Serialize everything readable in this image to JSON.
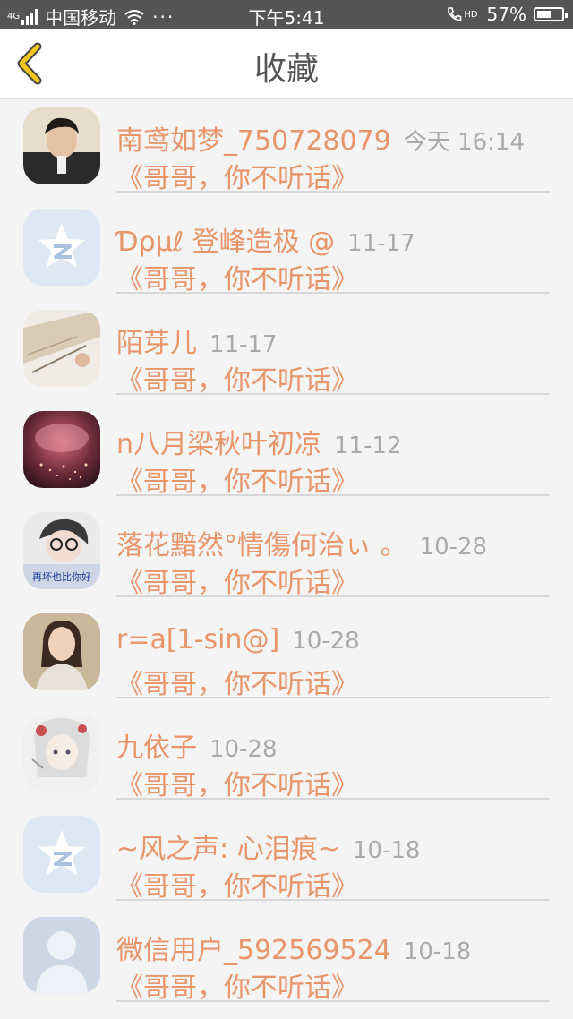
{
  "status_bar": {
    "carrier": "中国移动",
    "time": "下午5:41",
    "battery": "57%",
    "battery_level": 0.57,
    "network": "4G",
    "hd": "HD"
  },
  "header": {
    "title": "收藏"
  },
  "favorites": [
    {
      "name": "南鸢如梦_750728079",
      "time": "今天 16:14",
      "content": "《哥哥，你不听话》",
      "avatar": "photo-boy"
    },
    {
      "name": "Ɗρμℓ 登峰造极 @",
      "time": "11-17",
      "content": "《哥哥，你不听话》",
      "avatar": "qzone-star"
    },
    {
      "name": "陌芽儿",
      "time": "11-17",
      "content": "《哥哥，你不听话》",
      "avatar": "photo-sketch"
    },
    {
      "name": "n八月梁秋叶初凉",
      "time": "11-12",
      "content": "《哥哥，你不听话》",
      "avatar": "photo-red-lights"
    },
    {
      "name": "落花黯然°情傷何治ぃ 。",
      "time": "10-28",
      "content": "《哥哥，你不听话》",
      "avatar": "photo-boy-glasses",
      "avatar_caption": "再坏也比你好"
    },
    {
      "name": "r=a[1-sin@]",
      "time": "10-28",
      "content": "《哥哥，你不听话》",
      "avatar": "photo-woman"
    },
    {
      "name": "九依子",
      "time": "10-28",
      "content": "《哥哥，你不听话》",
      "avatar": "photo-anime-girl"
    },
    {
      "name": "~风之声: 心泪痕~",
      "time": "10-18",
      "content": "《哥哥，你不听话》",
      "avatar": "qzone-star"
    },
    {
      "name": "微信用户_592569524",
      "time": "10-18",
      "content": "《哥哥，你不听话》",
      "avatar": "default-user"
    }
  ]
}
